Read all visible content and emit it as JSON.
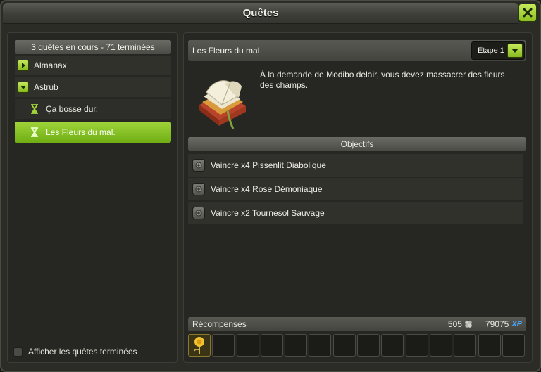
{
  "window": {
    "title": "Quêtes"
  },
  "left": {
    "summary": "3 quêtes en cours - 71 terminées",
    "tree": [
      {
        "label": "Almanax",
        "type": "category",
        "expanded": false
      },
      {
        "label": "Astrub",
        "type": "category",
        "expanded": true
      },
      {
        "label": "Ça bosse dur.",
        "type": "quest",
        "selected": false
      },
      {
        "label": "Les Fleurs du mal.",
        "type": "quest",
        "selected": true
      }
    ],
    "show_finished_label": "Afficher les quêtes terminées",
    "show_finished_checked": false
  },
  "quest": {
    "name": "Les Fleurs du mal",
    "step": "Étape 1",
    "description": "À la demande de Modibo delair, vous devez massacrer des fleurs des champs.",
    "objectives_title": "Objectifs",
    "objectives": [
      "Vaincre x4 Pissenlit Diabolique",
      "Vaincre x4 Rose Démoniaque",
      "Vaincre x2 Tournesol Sauvage"
    ]
  },
  "rewards": {
    "label": "Récompenses",
    "kamas": "505",
    "xp": "79075",
    "xp_unit": "XP",
    "slot_count": 14,
    "filled_slots": 1
  },
  "colors": {
    "accent_green": "#8dbf22",
    "xp_blue": "#4aa8ff"
  }
}
